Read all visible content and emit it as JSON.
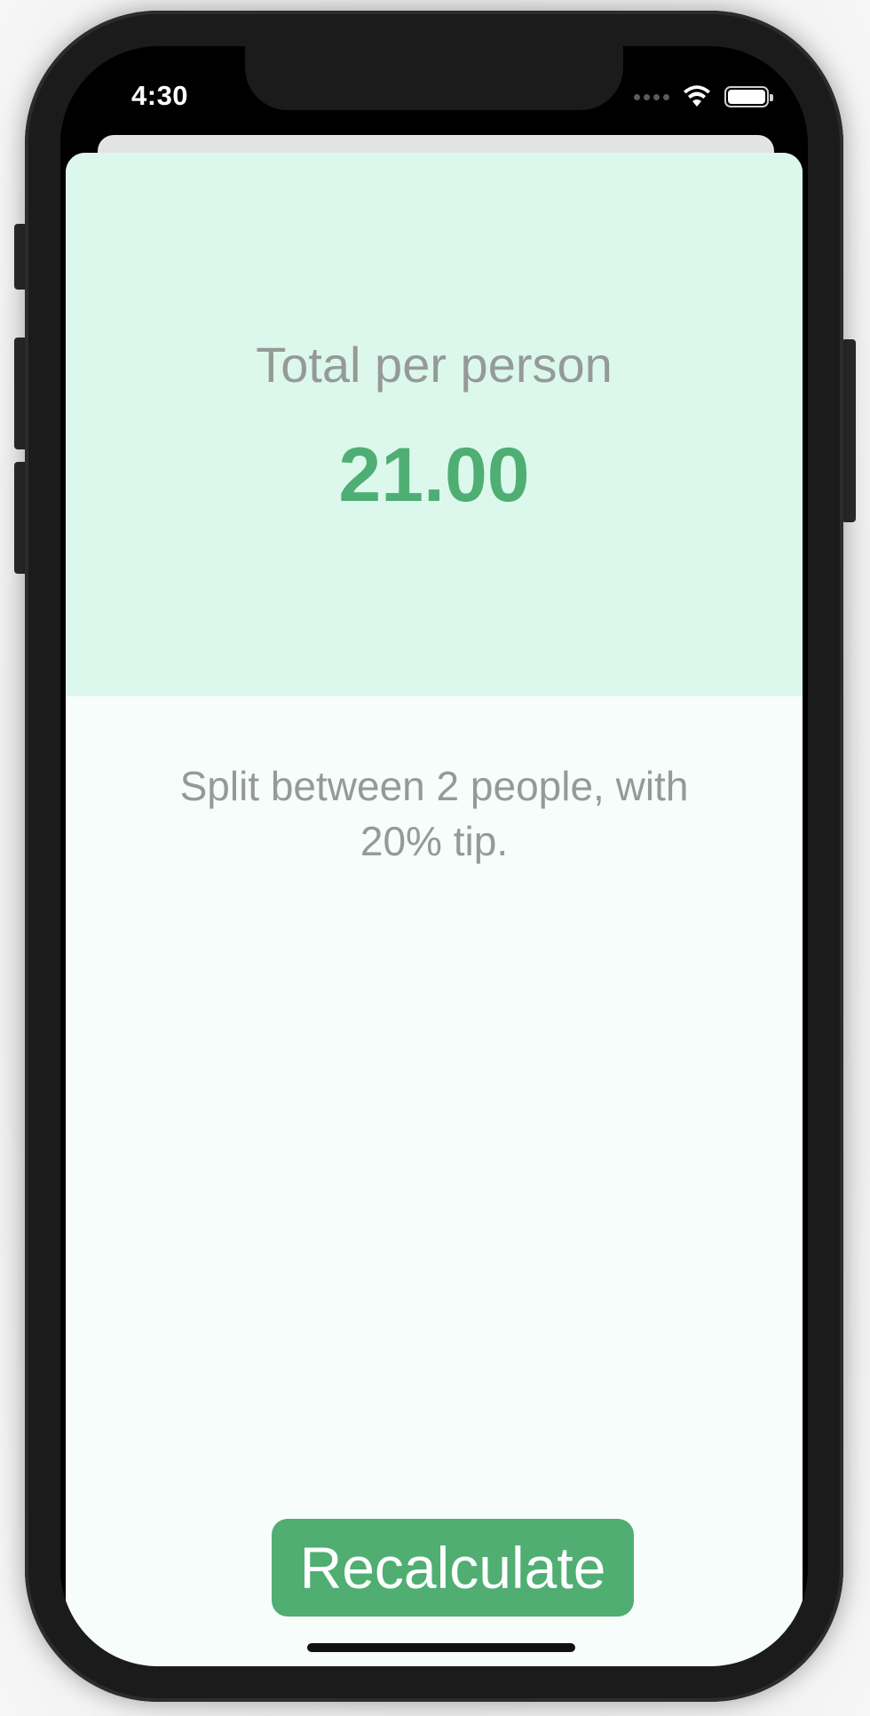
{
  "status_bar": {
    "time": "4:30",
    "icons": [
      "cellular-signal-icon",
      "wifi-icon",
      "battery-icon"
    ]
  },
  "result": {
    "label": "Total per person",
    "value": "21.00"
  },
  "summary": {
    "text": "Split between 2 people, with 20% tip."
  },
  "actions": {
    "recalculate_label": "Recalculate"
  },
  "colors": {
    "accent_green": "#50ae73",
    "result_panel_bg": "#dcf8ec",
    "sheet_bg": "#f6fdfb",
    "muted_text": "#959a98"
  }
}
